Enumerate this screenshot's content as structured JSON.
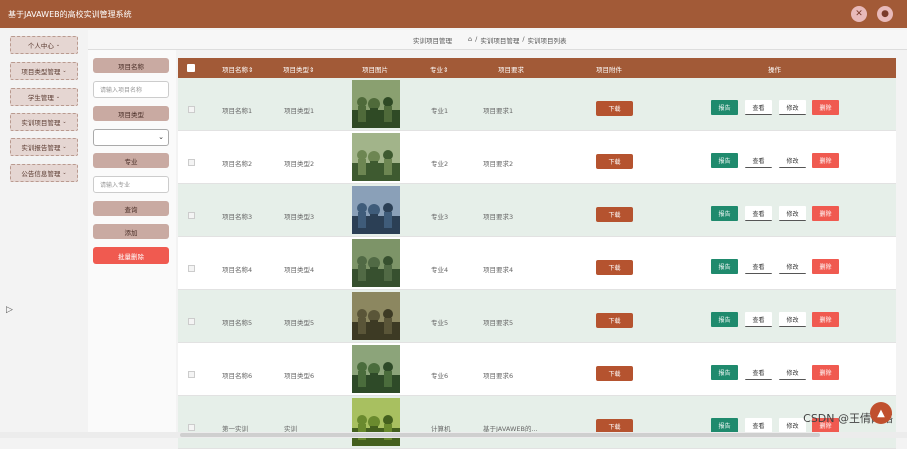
{
  "app": {
    "title": "基于JAVAWEB的高校实训管理系统"
  },
  "topbar": {
    "icons": [
      "fullscreen-icon",
      "user-icon"
    ]
  },
  "sidebar": {
    "items": [
      {
        "label": "个人中心"
      },
      {
        "label": "项目类型管理"
      },
      {
        "label": "学生管理"
      },
      {
        "label": "实训项目管理"
      },
      {
        "label": "实训报告管理"
      },
      {
        "label": "公告信息管理"
      }
    ]
  },
  "breadcrumb": {
    "title": "实训项目管理",
    "home_icon": "home-icon",
    "path": [
      "实训项目管理",
      "实训项目列表"
    ],
    "separator": "/"
  },
  "search": {
    "name_label": "项目名称",
    "name_placeholder": "请输入项目名称",
    "type_label": "项目类型",
    "type_value": "",
    "major_label": "专业",
    "major_placeholder": "请输入专业",
    "query_button": "查询",
    "add_button": "添加",
    "batch_delete_button": "批量删除"
  },
  "table": {
    "headers": {
      "name": "项目名称",
      "type": "项目类型",
      "image": "项目图片",
      "major": "专业",
      "requirement": "项目要求",
      "attachment": "项目附件",
      "actions": "操作"
    },
    "sort_icon": "sort-icon",
    "rows": [
      {
        "name": "项目名称1",
        "type": "项目类型1",
        "major": "专业1",
        "requirement": "项目要求1"
      },
      {
        "name": "项目名称2",
        "type": "项目类型2",
        "major": "专业2",
        "requirement": "项目要求2"
      },
      {
        "name": "项目名称3",
        "type": "项目类型3",
        "major": "专业3",
        "requirement": "项目要求3"
      },
      {
        "name": "项目名称4",
        "type": "项目类型4",
        "major": "专业4",
        "requirement": "项目要求4"
      },
      {
        "name": "项目名称5",
        "type": "项目类型5",
        "major": "专业5",
        "requirement": "项目要求5"
      },
      {
        "name": "项目名称6",
        "type": "项目类型6",
        "major": "专业6",
        "requirement": "项目要求6"
      },
      {
        "name": "第一实训",
        "type": "实训",
        "major": "计算机",
        "requirement": "基于JAVAWEB的..."
      }
    ],
    "row_buttons": {
      "download": "下载",
      "report": "报告",
      "view": "查看",
      "edit": "修改",
      "delete": "删除"
    }
  },
  "colors": {
    "brand": "#a25a37",
    "teal": "#1f8a6d",
    "danger": "#f05a50"
  },
  "watermark": "CSDN @王倩网络"
}
